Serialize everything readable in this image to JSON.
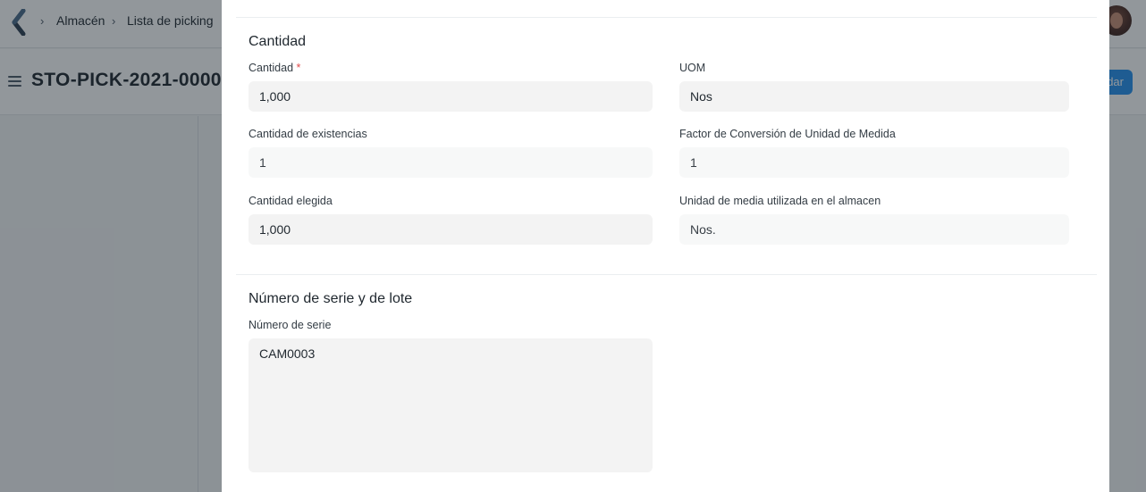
{
  "navbar": {
    "breadcrumbs": [
      "Almacén",
      "Lista de picking"
    ]
  },
  "page": {
    "title": "STO-PICK-2021-0000",
    "primary_button": "dar"
  },
  "modal": {
    "sections": [
      {
        "title": "Cantidad",
        "fields": {
          "cantidad_label": "Cantidad",
          "cantidad_required": "*",
          "cantidad_value": "1,000",
          "uom_label": "UOM",
          "uom_value": "Nos",
          "stock_qty_label": "Cantidad de existencias",
          "stock_qty_value": "1",
          "conversion_label": "Factor de Conversión de Unidad de Medida",
          "conversion_value": "1",
          "picked_qty_label": "Cantidad elegida",
          "picked_qty_value": "1,000",
          "stock_uom_label": "Unidad de media utilizada en el almacen",
          "stock_uom_value": "Nos."
        }
      },
      {
        "title": "Número de serie y de lote",
        "fields": {
          "serial_label": "Número de serie",
          "serial_value": "CAM0003"
        }
      }
    ]
  }
}
